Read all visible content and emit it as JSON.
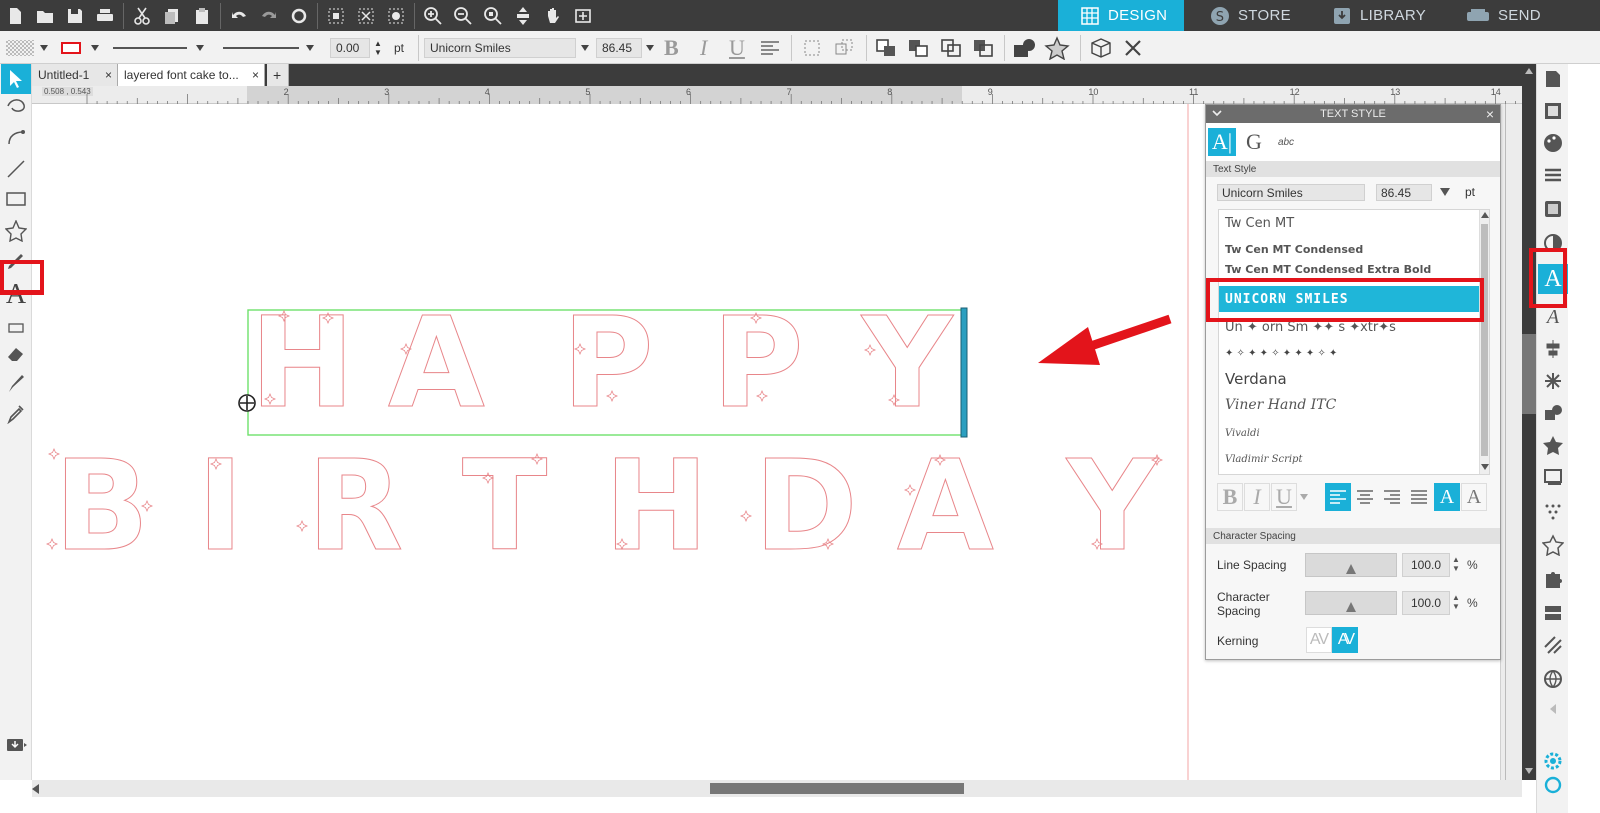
{
  "toolbar": {
    "icons": [
      "new-document-icon",
      "open-folder-icon",
      "save-icon",
      "print-icon",
      "cut-icon",
      "copy-icon",
      "paste-icon",
      "undo-icon",
      "redo-icon",
      "refresh-icon",
      "select-all-icon",
      "deselect-icon",
      "edit-points-icon",
      "zoom-in-icon",
      "zoom-out-icon",
      "zoom-select-icon",
      "move-icon",
      "pan-hand-icon",
      "fit-to-page-icon"
    ]
  },
  "modes": [
    {
      "label": "DESIGN",
      "icon": "grid-icon",
      "active": true
    },
    {
      "label": "STORE",
      "icon": "store-icon",
      "active": false
    },
    {
      "label": "LIBRARY",
      "icon": "library-icon",
      "active": false
    },
    {
      "label": "SEND",
      "icon": "send-icon",
      "active": false
    }
  ],
  "properties": {
    "line_width_value": "0.00",
    "line_width_unit": "pt",
    "font_name": "Unicorn Smiles",
    "font_size": "86.45",
    "bold_label": "B",
    "italic_label": "I",
    "underline_label": "U"
  },
  "tabs": [
    {
      "label": "Untitled-1",
      "close": "×",
      "active": false
    },
    {
      "label": "layered font cake to...",
      "close": "×",
      "active": true
    }
  ],
  "add_tab": "+",
  "ruler": {
    "readout": "0.508 , 0.543",
    "numbers": [
      "2",
      "3",
      "4",
      "5",
      "6",
      "7",
      "8",
      "9",
      "10",
      "11",
      "12",
      "13",
      "14"
    ]
  },
  "canvas": {
    "line1": "HAPPY",
    "line2": "BIRTHDAY",
    "glyph_color": "#e8868a",
    "selection_color": "#6ee06b"
  },
  "text_style_panel": {
    "title": "TEXT STYLE",
    "close": "×",
    "tabs": [
      {
        "name": "text-style-tab",
        "label": "A|"
      },
      {
        "name": "glyph-tab",
        "label": "G"
      },
      {
        "name": "spell-tab",
        "label": "abc"
      }
    ],
    "section_label": "Text Style",
    "font_name": "Unicorn Smiles",
    "font_size": "86.45",
    "size_unit": "pt",
    "fonts": [
      {
        "label": "Tw Cen MT",
        "selected": false
      },
      {
        "label": "Tw Cen MT Condensed",
        "selected": false
      },
      {
        "label": "Tw Cen MT Condensed Extra Bold",
        "selected": false
      },
      {
        "label": "UNICORN SMILES",
        "selected": true
      },
      {
        "label": "Un ✦ orn  Sm ✦✦ s  ✦xtr✦s",
        "selected": false
      },
      {
        "label": "✦ ✧ ✦ ✦ ✧ ✦ ✦ ✦ ✧ ✦",
        "selected": false
      },
      {
        "label": "Verdana",
        "selected": false
      },
      {
        "label": "Viner Hand ITC",
        "selected": false
      },
      {
        "label": "Vivaldi",
        "selected": false
      },
      {
        "label": "Vladimir Script",
        "selected": false
      }
    ],
    "format_labels": {
      "bold": "B",
      "italic": "I",
      "underline": "U"
    },
    "character_spacing": {
      "section_label": "Character Spacing",
      "line_spacing_label": "Line Spacing",
      "line_spacing_value": "100.0",
      "char_spacing_label": "Character Spacing",
      "char_spacing_value": "100.0",
      "unit": "%",
      "kerning_label": "Kerning",
      "kerning_off": "AV",
      "kerning_on": "AV"
    }
  },
  "colors": {
    "accent": "#1ab0d8",
    "highlight": "#e3141b",
    "menubar": "#3c3c3c"
  }
}
